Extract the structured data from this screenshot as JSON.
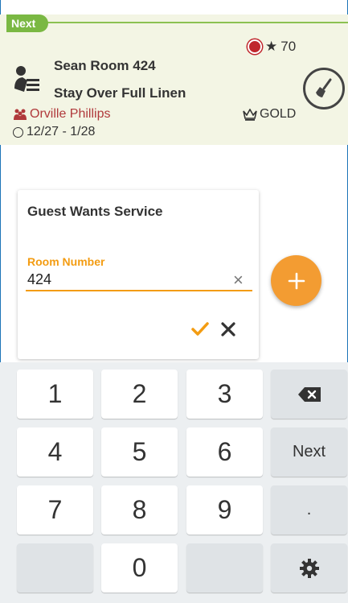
{
  "card": {
    "tag": "Next",
    "title": "Sean Room 424",
    "subtitle": "Stay Over Full Linen",
    "guest": "Orville Phillips",
    "dates": "12/27 - 1/28",
    "score": "70",
    "tier": "GOLD"
  },
  "dialog": {
    "title": "Guest Wants Service",
    "field_label": "Room Number",
    "field_value": "424"
  },
  "keyboard": {
    "rows": [
      [
        "1",
        "2",
        "3"
      ],
      [
        "4",
        "5",
        "6"
      ],
      [
        "7",
        "8",
        "9"
      ],
      [
        "",
        "0",
        ""
      ]
    ],
    "next_label": "Next",
    "period_label": "."
  },
  "colors": {
    "accent": "#f39c12",
    "green": "#7ab843",
    "card_bg": "#f3f5e4",
    "guest_red": "#b0393b"
  }
}
